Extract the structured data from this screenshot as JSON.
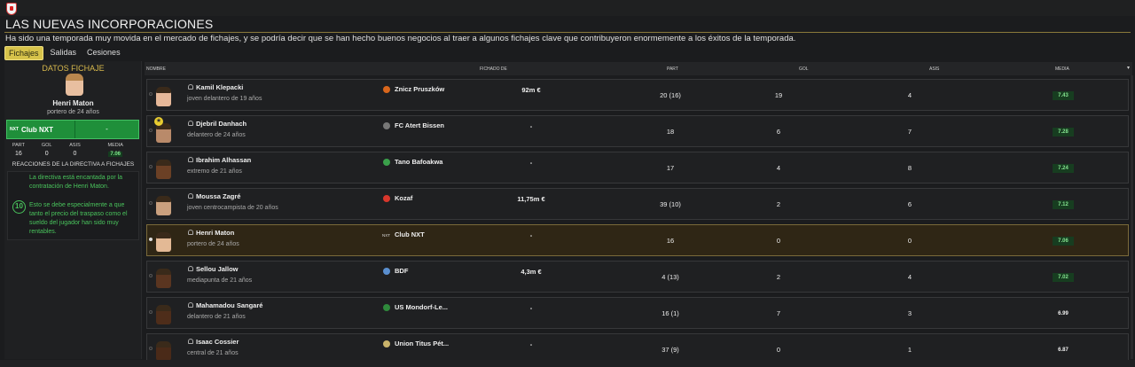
{
  "header": {
    "title": "LAS NUEVAS INCORPORACIONES",
    "subtitle": "Ha sido una temporada muy movida en el mercado de fichajes, y se podría decir que se han hecho buenos negocios al traer a algunos fichajes clave que contribuyeron enormemente a los éxitos de la temporada."
  },
  "tabs": [
    {
      "label": "Fichajes",
      "active": true
    },
    {
      "label": "Salidas",
      "active": false
    },
    {
      "label": "Cesiones",
      "active": false
    }
  ],
  "detail": {
    "heading": "DATOS FICHAJE",
    "player_name": "Henri Maton",
    "player_desc": "portero de 24 años",
    "club_badge": "NXT",
    "club_name": "Club NXT",
    "fee": "-",
    "stats_headers": [
      "PART",
      "GOL",
      "ASIS",
      "MEDIA"
    ],
    "stats_values": [
      "16",
      "0",
      "0",
      "7.06"
    ],
    "reactions_heading": "REACCIONES DE LA DIRECTIVA A FICHAJES",
    "reaction_1": "La directiva está encantada por la contratación de Henri Maton.",
    "reaction_score": "10",
    "reaction_2": "Esto se debe especialmente a que tanto el precio del traspaso como el sueldo del jugador han sido muy rentables."
  },
  "table": {
    "headers": {
      "name": "NOMBRE",
      "fee": "FICHADO DE",
      "part": "PART",
      "gol": "GOL",
      "asis": "ASIS",
      "media": "MEDIA"
    },
    "rows": [
      {
        "name": "Kamil Klepacki",
        "desc": "joven delantero de 19 años",
        "club": "Znicz Pruszków",
        "fee": "92m €",
        "part": "20 (16)",
        "gol": "19",
        "asis": "4",
        "media": "7.43",
        "green": true,
        "skin": "#e6b899",
        "badge": "#d8661c"
      },
      {
        "name": "Djebril Danhach",
        "desc": "delantero de 24 años",
        "club": "FC Atert Bissen",
        "fee": "-",
        "part": "18",
        "gol": "6",
        "asis": "7",
        "media": "7.28",
        "green": true,
        "skin": "#b98a6a",
        "badge": "#777777",
        "star": true
      },
      {
        "name": "Ibrahim Alhassan",
        "desc": "extremo de 21 años",
        "club": "Tano Bafoakwa",
        "fee": "-",
        "part": "17",
        "gol": "4",
        "asis": "8",
        "media": "7.24",
        "green": true,
        "skin": "#6b4025",
        "badge": "#3aa04a"
      },
      {
        "name": "Moussa Zagré",
        "desc": "joven centrocampista de 20 años",
        "club": "Kozaf",
        "fee": "11,75m €",
        "part": "39 (10)",
        "gol": "2",
        "asis": "6",
        "media": "7.12",
        "green": true,
        "skin": "#caa07e",
        "badge": "#d8372c"
      },
      {
        "name": "Henri Maton",
        "desc": "portero de 24 años",
        "club": "Club NXT",
        "fee": "-",
        "part": "16",
        "gol": "0",
        "asis": "0",
        "media": "7.06",
        "green": true,
        "skin": "#e3b995",
        "badge_text": "NXT",
        "selected": true
      },
      {
        "name": "Sellou Jallow",
        "desc": "mediapunta de 21 años",
        "club": "BDF",
        "fee": "4,3m €",
        "part": "4 (13)",
        "gol": "2",
        "asis": "4",
        "media": "7.02",
        "green": true,
        "skin": "#5a3520",
        "badge": "#5a8fd0"
      },
      {
        "name": "Mahamadou Sangaré",
        "desc": "delantero de 21 años",
        "club": "US Mondorf-Le...",
        "fee": "-",
        "part": "16 (1)",
        "gol": "7",
        "asis": "3",
        "media": "6.99",
        "green": false,
        "skin": "#4e2d1a",
        "badge": "#2f8a3c"
      },
      {
        "name": "Isaac Cossier",
        "desc": "central de 21 años",
        "club": "Union Titus Pét...",
        "fee": "-",
        "part": "37 (9)",
        "gol": "0",
        "asis": "1",
        "media": "6.87",
        "green": false,
        "skin": "#4a2a18",
        "badge": "#c9b36a"
      }
    ]
  }
}
